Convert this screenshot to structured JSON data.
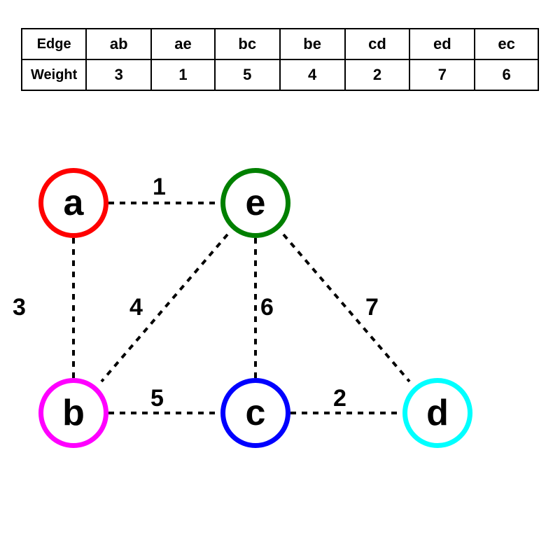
{
  "table": {
    "headers": [
      "Edge",
      "ab",
      "ae",
      "bc",
      "be",
      "cd",
      "ed",
      "ec"
    ],
    "rows": [
      {
        "label": "Weight",
        "values": [
          "3",
          "1",
          "5",
          "4",
          "2",
          "7",
          "6"
        ]
      }
    ]
  },
  "nodes": [
    {
      "id": "a",
      "label": "a",
      "color": "red"
    },
    {
      "id": "e",
      "label": "e",
      "color": "green"
    },
    {
      "id": "b",
      "label": "b",
      "color": "magenta"
    },
    {
      "id": "c",
      "label": "c",
      "color": "blue"
    },
    {
      "id": "d",
      "label": "d",
      "color": "cyan"
    }
  ],
  "edges": [
    {
      "from": "a",
      "to": "e",
      "weight": "1"
    },
    {
      "from": "a",
      "to": "b",
      "weight": "3"
    },
    {
      "from": "e",
      "to": "b",
      "weight": "4"
    },
    {
      "from": "e",
      "to": "c",
      "weight": "6"
    },
    {
      "from": "e",
      "to": "d",
      "weight": "7"
    },
    {
      "from": "b",
      "to": "c",
      "weight": "5"
    },
    {
      "from": "c",
      "to": "d",
      "weight": "2"
    }
  ]
}
